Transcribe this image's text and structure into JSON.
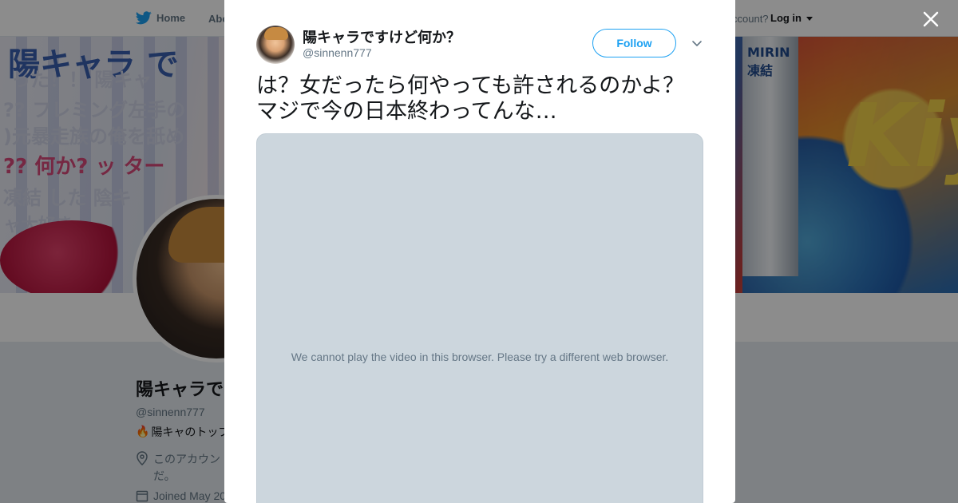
{
  "nav": {
    "home_label": "Home",
    "about_label": "Abo",
    "account_prompt": "ccount?",
    "login_label": "Log in"
  },
  "banner": {
    "lines": [
      "陽キャラ で",
      "った！！  陽キャ",
      "??  フレミング左手の",
      ")元暴走族の俺を舐め",
      "??  何か?  ッ  ター",
      "凍結  した  陰キ",
      "ャ大好き"
    ],
    "can_text": "MIRIN 凍結",
    "comic_text": "Kiy"
  },
  "profile": {
    "name": "陽キャラで",
    "handle": "@sinnenn777",
    "bio_emoji": "🔥",
    "bio": "陽キャのトップ",
    "location_line1": "このアカウン",
    "location_line2": "だ。",
    "joined": "Joined May 20"
  },
  "tweet": {
    "author_name": "陽キャラですけど何か？",
    "author_handle": "@sinnenn777",
    "follow_label": "Follow",
    "text": "は？女だったら何やっても許されるのかよ？マジで今の日本終わってんな…",
    "video_message": "We cannot play the video in this browser. Please try a different web browser."
  },
  "colors": {
    "accent": "#1da1f2",
    "text_primary": "#14171a",
    "text_secondary": "#657786",
    "video_placeholder": "#ccd6dd"
  },
  "icons": {
    "nav": "twitter-bird-icon",
    "close": "close-icon",
    "caret": "chevron-down-icon",
    "location": "location-pin-icon",
    "calendar": "calendar-icon"
  }
}
